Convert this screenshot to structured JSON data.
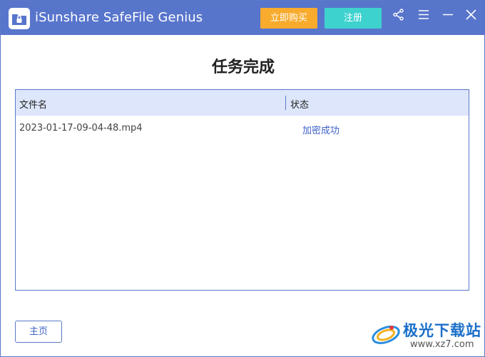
{
  "window": {
    "app_title": "iSunshare SafeFile Genius",
    "buy_label": "立即购买",
    "register_label": "注册",
    "colors": {
      "titlebar": "#5875cc",
      "buy": "#f8ab2c",
      "register": "#3ed2cf",
      "accent": "#3f62c6"
    }
  },
  "icons": {
    "app": "folder-lock-icon",
    "share": "share-icon",
    "menu": "menu-icon",
    "minimize": "minimize-icon",
    "close": "close-icon"
  },
  "main": {
    "title": "任务完成",
    "table": {
      "columns": [
        "文件名",
        "状态"
      ],
      "rows": [
        {
          "filename": "2023-01-17-09-04-48.mp4",
          "status": "加密成功"
        }
      ]
    },
    "home_label": "主页"
  },
  "watermark": {
    "text": "极光下载站",
    "url": "www.xz7.com"
  }
}
